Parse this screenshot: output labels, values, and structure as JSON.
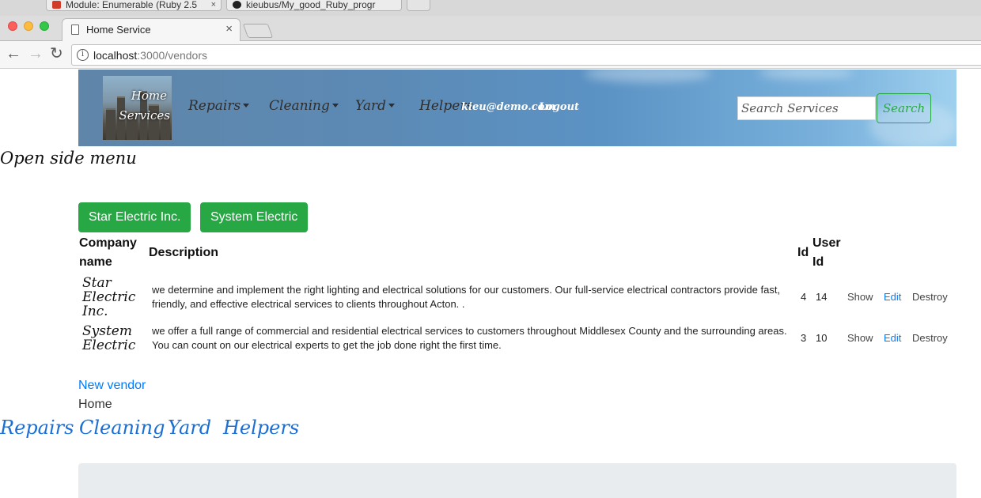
{
  "browser": {
    "background_tabs": [
      "Module: Enumerable (Ruby 2.5",
      "kieubus/My_good_Ruby_progr"
    ],
    "active_tab_title": "Home Service",
    "active_tab_close": "×",
    "url_host": "localhost",
    "url_path": ":3000/vendors",
    "icons": [
      "back-arrow-icon",
      "forward-arrow-icon",
      "reload-icon",
      "info-icon"
    ]
  },
  "header": {
    "logo_line1": "Home",
    "logo_line2": "Services",
    "nav": [
      {
        "label": "Repairs",
        "has_caret": true
      },
      {
        "label": "Cleaning",
        "has_caret": true
      },
      {
        "label": "Yard",
        "has_caret": true
      },
      {
        "label": "Helpers",
        "has_caret": false
      }
    ],
    "user_email": "kieu@demo.com",
    "logout_label": "Logout",
    "search_placeholder": "Search Services",
    "search_button": "Search"
  },
  "side_menu_label": "Open side menu",
  "vendor_buttons": [
    "Star Electric Inc.",
    "System Electric"
  ],
  "table": {
    "headers": {
      "company_line1": "Company",
      "company_line2": "name",
      "description": "Description",
      "id": "Id",
      "user_id_line1": "User",
      "user_id_line2": "Id"
    },
    "rows": [
      {
        "company_lines": [
          "Star",
          "Electric",
          "Inc."
        ],
        "description": "we determine and implement the right lighting and electrical solutions for our customers. Our full-service electrical contractors provide fast, friendly, and effective electrical services to clients throughout Acton. .",
        "id": "4",
        "user_id": "14",
        "show": "Show",
        "edit": "Edit",
        "destroy": "Destroy"
      },
      {
        "company_lines": [
          "System",
          "Electric"
        ],
        "description": "we offer a full range of commercial and residential electrical services to customers throughout Middlesex County and the surrounding areas. You can count on our electrical experts to get the job done right the first time.",
        "id": "3",
        "user_id": "10",
        "show": "Show",
        "edit": "Edit",
        "destroy": "Destroy"
      }
    ]
  },
  "new_vendor_link": "New vendor",
  "home_text": "Home",
  "footer_links": [
    "Repairs",
    "Cleaning",
    "Yard",
    "Helpers"
  ],
  "colors": {
    "success": "#28a745",
    "link": "#007bff",
    "footer_link": "#1a6fd6",
    "jumbotron": "#e9ecef"
  }
}
